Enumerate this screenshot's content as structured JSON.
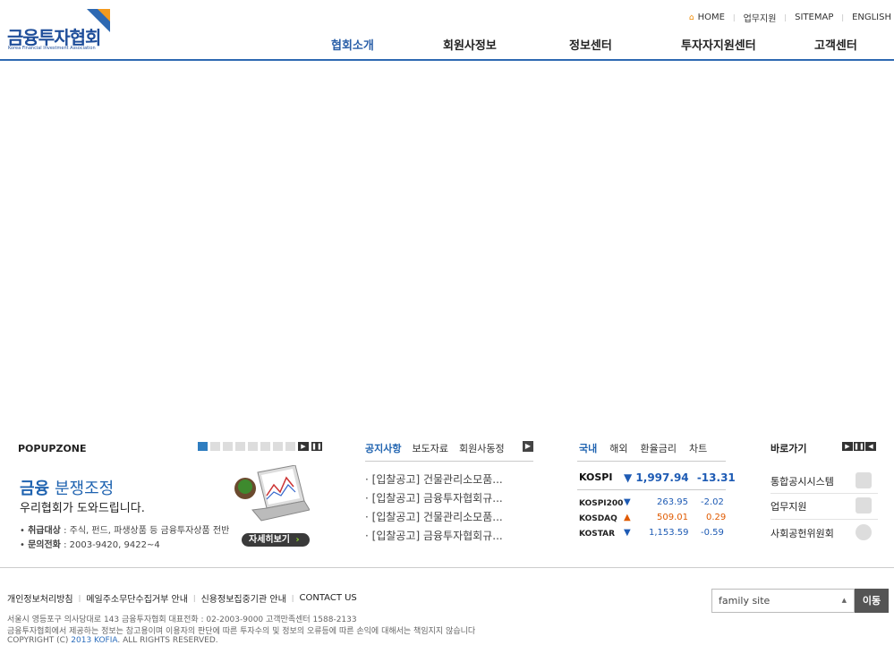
{
  "header": {
    "logo_title": "금융투자협회",
    "logo_sub": "Korea Financial Investment Association",
    "util": [
      "HOME",
      "업무지원",
      "SITEMAP",
      "ENGLISH"
    ],
    "gnb": [
      "협회소개",
      "회원사정보",
      "정보센터",
      "투자자지원센터",
      "고객센터"
    ]
  },
  "popup": {
    "title": "POPUPZONE",
    "heading_a": "금융",
    "heading_b": "분쟁조정",
    "sub": "우리협회가 도와드립니다.",
    "line1_label": "취급대상",
    "line1_text": "주식, 펀드, 파생상품 등 금융투자상품 전반",
    "line2_label": "문의전화",
    "line2_text": "2003-9420, 9422~4",
    "more": "자세히보기"
  },
  "notice": {
    "tabs": [
      "공지사항",
      "보도자료",
      "회원사동정"
    ],
    "items": [
      "[입찰공고] 건물관리소모품...",
      "[입찰공고] 금융투자협회규...",
      "[입찰공고] 건물관리소모품...",
      "[입찰공고] 금융투자협회규..."
    ]
  },
  "market": {
    "tabs": [
      "국내",
      "해외",
      "환율금리",
      "차트"
    ],
    "kospi_label": "KOSPI",
    "kospi_value": "1,997.94",
    "kospi_change": "-13.31",
    "rows": [
      {
        "name": "KOSPI200",
        "value": "263.95",
        "change": "-2.02",
        "dir": "down"
      },
      {
        "name": "KOSDAQ",
        "value": "509.01",
        "change": "0.29",
        "dir": "up"
      },
      {
        "name": "KOSTAR",
        "value": "1,153.59",
        "change": "-0.59",
        "dir": "down"
      }
    ]
  },
  "quick": {
    "title": "바로가기",
    "items": [
      "통합공시시스템",
      "업무지원",
      "사회공헌위원회"
    ]
  },
  "footer": {
    "links": [
      "개인정보처리방침",
      "메일주소무단수집거부 안내",
      "신용정보집중기관 안내",
      "CONTACT US"
    ],
    "family_site": "family site",
    "go": "이동",
    "addr1": "서울시 영등포구 의사당대로 143 금융투자협회   대표전화 : 02-2003-9000    고객만족센터 1588-2133",
    "addr2": "금융투자협회에서 제공하는 정보는 참고용이며 이용자의 판단에 따른 투자수의 및 정보의 오류등에 따른 손익에 대해서는 책임지지 않습니다",
    "copyright_a": "COPYRIGHT (C)",
    "copyright_b": "2013 KOFIA",
    "copyright_c": ". ALL RIGHTS RESERVED."
  }
}
